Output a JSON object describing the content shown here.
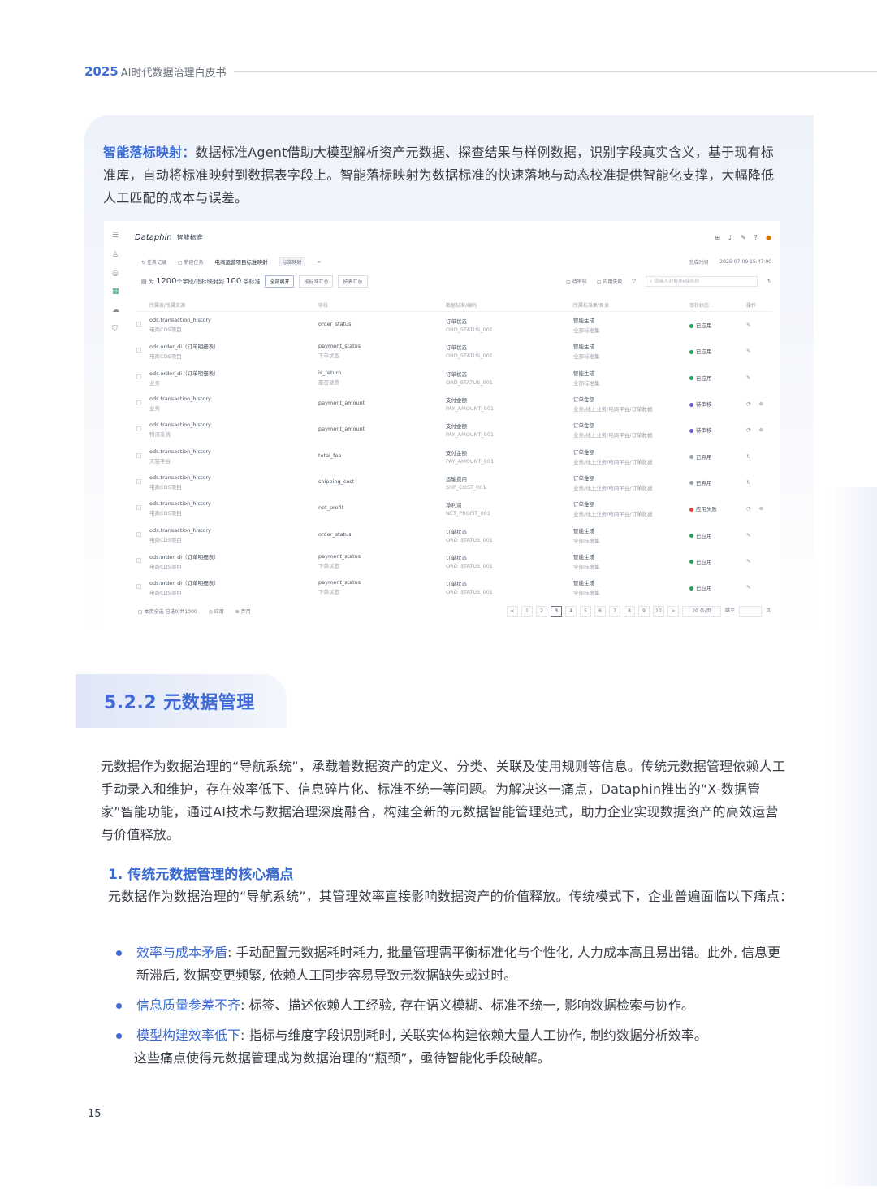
{
  "header": {
    "year": "2025",
    "title": "AI时代数据治理白皮书"
  },
  "intro": {
    "highlight": "智能落标映射：",
    "text": "数据标准Agent借助大模型解析资产元数据、探查结果与样例数据，识别字段真实含义，基于现有标准库，自动将标准映射到数据表字段上。智能落标映射为数据标准的快速落地与动态校准提供智能化支撑，大幅降低人工匹配的成本与误差。"
  },
  "app": {
    "logo": "Dataphin",
    "product": "智能标准",
    "side_icons": [
      "menu-icon",
      "person-icon",
      "asset-icon",
      "grid-icon",
      "cloud-icon",
      "shield-icon"
    ],
    "toolbar1": {
      "record": "任务记录",
      "new_task": "新建任务",
      "task_name": "电商运营项目标准映射",
      "tag": "标准映射",
      "time_label": "完成时间",
      "time": "2025-07-09 15:47:00"
    },
    "toolbar2": {
      "summary_prefix": "为",
      "summary_fields": "1200",
      "summary_mid": "个字段/指标映射到",
      "summary_std": "100",
      "summary_suffix": "条标准",
      "btn_all": "全部展开",
      "btn_std": "按标准汇总",
      "btn_tbl": "按表汇总",
      "filter_pending": "待审核",
      "filter_failed": "应用失败",
      "search_placeholder": "请输入对象/标准名称"
    },
    "columns": [
      "所属表/所属来源",
      "字段",
      "数据标准/编码",
      "所属标准集/目录",
      "审核状态",
      "操作"
    ],
    "rows": [
      {
        "table": "ods.transaction_history",
        "source": "电商CDS项目",
        "field": "order_status",
        "field_sub": "",
        "std": "订单状态",
        "code": "ORD_STATUS_001",
        "cat": "智能生成",
        "cat_sub": "全部标准集",
        "status": "已应用",
        "color": "#22a35a",
        "ops": "edit"
      },
      {
        "table": "ods.order_di（订单明细表）",
        "source": "电商CDS项目",
        "field": "payment_status",
        "field_sub": "下单状态",
        "std": "订单状态",
        "code": "ORD_STATUS_001",
        "cat": "智能生成",
        "cat_sub": "全部标准集",
        "status": "已应用",
        "color": "#22a35a",
        "ops": "edit"
      },
      {
        "table": "ods.order_di（订单明细表）",
        "source": "业务",
        "field": "is_return",
        "field_sub": "是否退货",
        "std": "订单状态",
        "code": "ORD_STATUS_001",
        "cat": "智能生成",
        "cat_sub": "全部标准集",
        "status": "已应用",
        "color": "#22a35a",
        "ops": "edit"
      },
      {
        "table": "ods.transaction_history",
        "source": "业务",
        "field": "payment_amount",
        "field_sub": "",
        "std": "支付金额",
        "code": "PAY_AMOUNT_001",
        "cat": "订单金额",
        "cat_sub": "业务/线上业务/电商平台/订单数据",
        "status": "待审核",
        "color": "#6b5bd6",
        "ops": "review"
      },
      {
        "table": "ods.transaction_history",
        "source": "物流系统",
        "field": "payment_amount",
        "field_sub": "",
        "std": "支付金额",
        "code": "PAY_AMOUNT_001",
        "cat": "订单金额",
        "cat_sub": "业务/线上业务/电商平台/订单数据",
        "status": "待审核",
        "color": "#6b5bd6",
        "ops": "review"
      },
      {
        "table": "ods.transaction_history",
        "source": "天猫平台",
        "field": "total_fee",
        "field_sub": "",
        "std": "支付金额",
        "code": "PAY_AMOUNT_001",
        "cat": "订单金额",
        "cat_sub": "业务/线上业务/电商平台/订单数据",
        "status": "已弃用",
        "color": "#9aa1ab",
        "ops": "restore"
      },
      {
        "table": "ods.transaction_history",
        "source": "电商CDS项目",
        "field": "shipping_cost",
        "field_sub": "",
        "std": "运输费用",
        "code": "SHP_COST_001",
        "cat": "订单金额",
        "cat_sub": "业务/线上业务/电商平台/订单数据",
        "status": "已弃用",
        "color": "#9aa1ab",
        "ops": "restore"
      },
      {
        "table": "ods.transaction_history",
        "source": "电商CDS项目",
        "field": "net_profit",
        "field_sub": "",
        "std": "净利润",
        "code": "NET_PROFIT_001",
        "cat": "订单金额",
        "cat_sub": "业务/线上业务/电商平台/订单数据",
        "status": "应用失败",
        "color": "#e0443c",
        "ops": "review"
      },
      {
        "table": "ods.transaction_history",
        "source": "电商CDS项目",
        "field": "order_status",
        "field_sub": "",
        "std": "订单状态",
        "code": "ORD_STATUS_001",
        "cat": "智能生成",
        "cat_sub": "全部标准集",
        "status": "已应用",
        "color": "#22a35a",
        "ops": "edit"
      },
      {
        "table": "ods.order_di（订单明细表）",
        "source": "电商CDS项目",
        "field": "payment_status",
        "field_sub": "下单状态",
        "std": "订单状态",
        "code": "ORD_STATUS_001",
        "cat": "智能生成",
        "cat_sub": "全部标准集",
        "status": "已应用",
        "color": "#22a35a",
        "ops": "edit"
      },
      {
        "table": "ods.order_di（订单明细表）",
        "source": "电商CDS项目",
        "field": "payment_status",
        "field_sub": "下单状态",
        "std": "订单状态",
        "code": "ORD_STATUS_001",
        "cat": "智能生成",
        "cat_sub": "全部标准集",
        "status": "已应用",
        "color": "#22a35a",
        "ops": "edit"
      }
    ],
    "footer": {
      "select_page": "本页全选",
      "selected": "已选0/共1000",
      "apply": "应用",
      "discard": "弃用",
      "pages": [
        "<",
        "1",
        "2",
        "3",
        "4",
        "5",
        "6",
        "7",
        "8",
        "9",
        "10",
        ">"
      ],
      "current_page": "3",
      "page_size": "20 条/页",
      "jump": "跳至",
      "page_unit": "页"
    }
  },
  "section": {
    "title": "5.2.2 元数据管理",
    "para1": "元数据作为数据治理的“导航系统”，承载着数据资产的定义、分类、关联及使用规则等信息。传统元数据管理依赖人工手动录入和维护，存在效率低下、信息碎片化、标准不统一等问题。为解决这一痛点，Dataphin推出的“X-数据管家”智能功能，通过AI技术与数据治理深度融合，构建全新的元数据智能管理范式，助力企业实现数据资产的高效运营与价值释放。",
    "subheading": "1.  传统元数据管理的核心痛点",
    "para2": "元数据作为数据治理的“导航系统”，其管理效率直接影响数据资产的价值释放。传统模式下，企业普遍面临以下痛点：",
    "bullets": [
      {
        "key": "效率与成本矛盾",
        "text": ": 手动配置元数据耗时耗力, 批量管理需平衡标准化与个性化, 人力成本高且易出错。此外, 信息更新滞后, 数据变更频繁, 依赖人工同步容易导致元数据缺失或过时。"
      },
      {
        "key": "信息质量参差不齐",
        "text": ": 标签、描述依赖人工经验, 存在语义模糊、标准不统一, 影响数据检索与协作。"
      },
      {
        "key": "模型构建效率低下",
        "text": ": 指标与维度字段识别耗时, 关联实体构建依赖大量人工协作, 制约数据分析效率。"
      }
    ],
    "closing": "这些痛点使得元数据管理成为数据治理的“瓶颈”，亟待智能化手段破解。"
  },
  "page_number": "15"
}
